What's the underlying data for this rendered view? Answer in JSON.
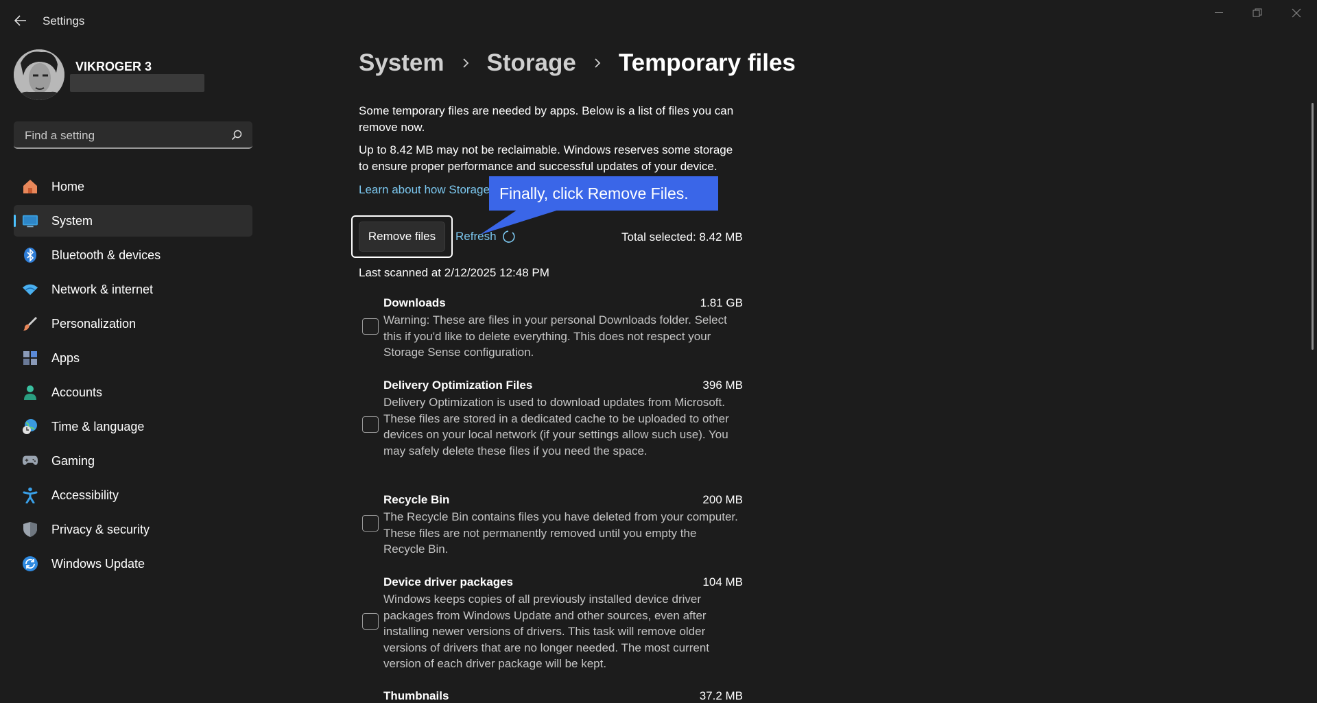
{
  "app": {
    "title": "Settings"
  },
  "window_controls": {
    "minimize_icon": "minimize-icon",
    "restore_icon": "restore-icon",
    "close_icon": "close-icon"
  },
  "profile": {
    "name": "VIKROGER 3"
  },
  "search": {
    "placeholder": "Find a setting"
  },
  "nav": {
    "items": [
      {
        "label": "Home",
        "icon": "home-icon"
      },
      {
        "label": "System",
        "icon": "system-icon",
        "active": true
      },
      {
        "label": "Bluetooth & devices",
        "icon": "bluetooth-icon"
      },
      {
        "label": "Network & internet",
        "icon": "wifi-icon"
      },
      {
        "label": "Personalization",
        "icon": "brush-icon"
      },
      {
        "label": "Apps",
        "icon": "apps-icon"
      },
      {
        "label": "Accounts",
        "icon": "accounts-icon"
      },
      {
        "label": "Time & language",
        "icon": "time-language-icon"
      },
      {
        "label": "Gaming",
        "icon": "gamepad-icon"
      },
      {
        "label": "Accessibility",
        "icon": "accessibility-icon"
      },
      {
        "label": "Privacy & security",
        "icon": "shield-icon"
      },
      {
        "label": "Windows Update",
        "icon": "update-icon"
      }
    ]
  },
  "breadcrumb": {
    "items": [
      "System",
      "Storage",
      "Temporary files"
    ]
  },
  "content": {
    "desc1": "Some temporary files are needed by apps. Below is a list of files you can remove now.",
    "desc2": "Up to 8.42 MB may not be reclaimable. Windows reserves some storage to ensure proper performance and successful updates of your device.",
    "learn_link": "Learn about how Storage",
    "remove_button": "Remove files",
    "refresh": "Refresh",
    "total_selected": "Total selected: 8.42 MB",
    "last_scanned": "Last scanned at 2/12/2025 12:48 PM"
  },
  "files": [
    {
      "title": "Downloads",
      "size": "1.81 GB",
      "checked": false,
      "desc": "Warning: These are files in your personal Downloads folder. Select this if you'd like to delete everything. This does not respect your Storage Sense configuration."
    },
    {
      "title": "Delivery Optimization Files",
      "size": "396 MB",
      "checked": false,
      "desc": "Delivery Optimization is used to download updates from Microsoft. These files are stored in a dedicated cache to be uploaded to other devices on your local network (if your settings allow such use). You may safely delete these files if you need the space."
    },
    {
      "title": "Recycle Bin",
      "size": "200 MB",
      "checked": false,
      "desc": "The Recycle Bin contains files you have deleted from your computer. These files are not permanently removed until you empty the Recycle Bin."
    },
    {
      "title": "Device driver packages",
      "size": "104 MB",
      "checked": false,
      "desc": "Windows keeps copies of all previously installed device driver packages from Windows Update and other sources, even after installing newer versions of drivers. This task will remove older versions of drivers that are no longer needed. The most current version of each driver package will be kept."
    },
    {
      "title": "Thumbnails",
      "size": "37.2 MB",
      "checked": false,
      "desc": ""
    }
  ],
  "callout": {
    "text": "Finally, click Remove Files."
  },
  "colors": {
    "background": "#1c1c1c",
    "accent": "#4cc2ff",
    "link": "#7cc8f0",
    "callout": "#3a66e8"
  }
}
